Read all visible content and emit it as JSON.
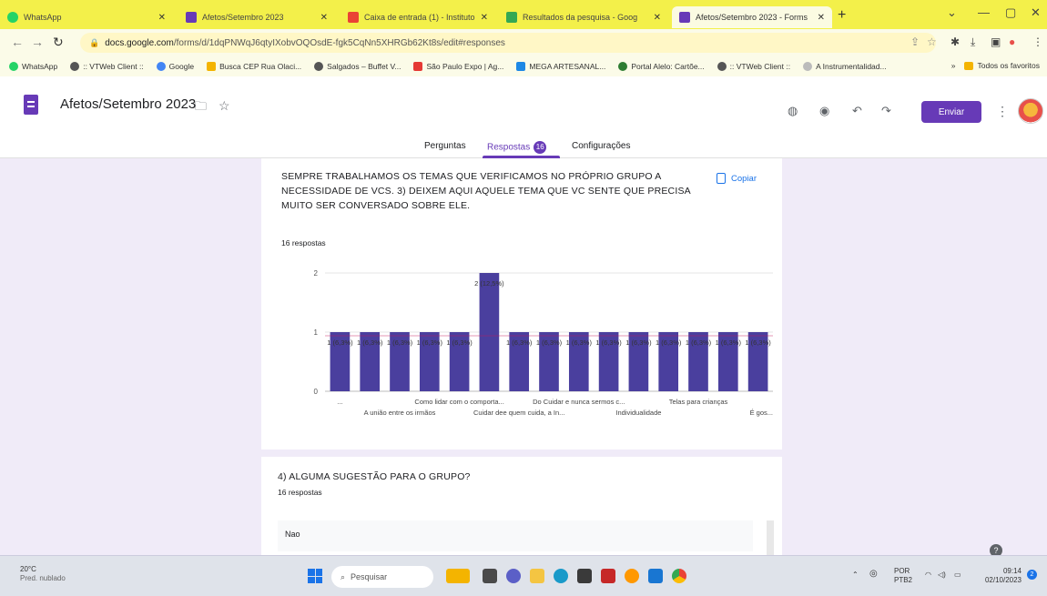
{
  "browser": {
    "tabs": [
      {
        "label": "WhatsApp",
        "color": "#25d366"
      },
      {
        "label": "Afetos/Setembro 2023",
        "color": "#673ab7"
      },
      {
        "label": "Caixa de entrada (1) - Instituto",
        "color": "#ea4335"
      },
      {
        "label": "Resultados da pesquisa - Goog",
        "color": "#34a853"
      },
      {
        "label": "Afetos/Setembro 2023 - Forms",
        "color": "#673ab7"
      }
    ],
    "url_domain": "docs.google.com",
    "url_path": "/forms/d/1dqPNWqJ6qtyIXobvOQOsdE-fgk5CqNn5XHRGb62Kt8s/edit#responses",
    "bookmarks": [
      {
        "label": "WhatsApp",
        "color": "#25d366"
      },
      {
        "label": ":: VTWeb Client ::",
        "color": "#555555"
      },
      {
        "label": "Google",
        "color": "#4285f4"
      },
      {
        "label": "Busca CEP Rua Olaci...",
        "color": "#f4b400"
      },
      {
        "label": "Salgados – Buffet V...",
        "color": "#555555"
      },
      {
        "label": "São Paulo Expo | Ag...",
        "color": "#e53935"
      },
      {
        "label": "MEGA ARTESANAL...",
        "color": "#1e88e5"
      },
      {
        "label": "Portal Alelo: Cartõe...",
        "color": "#2e7d32"
      },
      {
        "label": ":: VTWeb Client ::",
        "color": "#555555"
      },
      {
        "label": "A Instrumentalidad...",
        "color": "#777777"
      }
    ],
    "bookmarks_more": "»",
    "all_favorites": "Todos os favoritos"
  },
  "form": {
    "title": "Afetos/Setembro 2023",
    "send_label": "Enviar",
    "tabs": {
      "questions": "Perguntas",
      "responses": "Respostas",
      "responses_count": "16",
      "settings": "Configurações"
    }
  },
  "question3": {
    "text": "SEMPRE TRABALHAMOS OS TEMAS QUE VERIFICAMOS NO PRÓPRIO GRUPO A NECESSIDADE DE VCS. 3) DEIXEM AQUI AQUELE TEMA QUE VC SENTE QUE PRECISA MUITO SER CONVERSADO SOBRE ELE.",
    "responses_label": "16 respostas",
    "copy_label": "Copiar"
  },
  "chart_data": {
    "type": "bar",
    "ylim": [
      0,
      2
    ],
    "yticks": [
      0,
      1,
      2
    ],
    "values": [
      1,
      1,
      1,
      1,
      1,
      2,
      1,
      1,
      1,
      1,
      1,
      1,
      1,
      1,
      1
    ],
    "data_labels": [
      "1 (6,3%)",
      "1 (6,3%)",
      "1 (6,3%)",
      "1 (6,3%)",
      "1 (6,3%)",
      "2 (12,5%)",
      "1 (6,3%)",
      "1 (6,3%)",
      "1 (6,3%)",
      "1 (6,3%)",
      "1 (6,3%)",
      "1 (6,3%)",
      "1 (6,3%)",
      "1 (6,3%)",
      "1 (6,3%)"
    ],
    "category_labels": [
      {
        "index": 0,
        "text": "...",
        "row": 1
      },
      {
        "index": 2,
        "text": "A união entre os irmãos",
        "row": 2
      },
      {
        "index": 4,
        "text": "Como lidar com o comporta...",
        "row": 1
      },
      {
        "index": 6,
        "text": "Cuidar dee quem cuida, a In...",
        "row": 2
      },
      {
        "index": 8,
        "text": "Do Cuidar e nunca sermos c...",
        "row": 1
      },
      {
        "index": 10,
        "text": "Individualidade",
        "row": 2
      },
      {
        "index": 12,
        "text": "Telas para crianças",
        "row": 1
      },
      {
        "index": 14,
        "text": "É gos...",
        "row": 2
      }
    ],
    "bar_color": "#4a3f9e"
  },
  "question4": {
    "text": "4) ALGUMA SUGESTÃO PARA O GRUPO?",
    "responses_label": "16 respostas",
    "answers": [
      "Nao"
    ]
  },
  "taskbar": {
    "temperature": "20°C",
    "weather": "Pred. nublado",
    "search_placeholder": "Pesquisar",
    "lang": "POR",
    "layout": "PTB2",
    "time": "09:14",
    "date": "02/10/2023"
  }
}
